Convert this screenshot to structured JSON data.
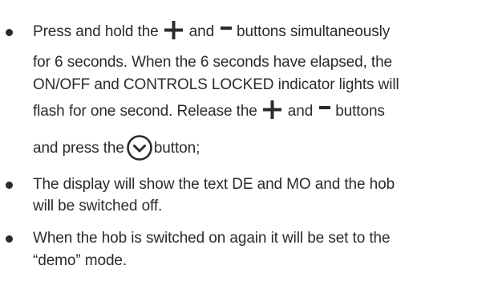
{
  "instructions": {
    "item1": {
      "line1": {
        "before_plus": "Press and hold the",
        "between": "and",
        "after_minus": "buttons simultaneously"
      },
      "line2": "for 6 seconds. When the 6 seconds have elapsed, the",
      "line3": "ON/OFF and CONTROLS LOCKED indicator lights will",
      "line4": {
        "before_plus": "flash for one second. Release the",
        "between": "and",
        "after_minus": "buttons"
      },
      "line5": {
        "before_icon": "and press the",
        "after_icon": "button;"
      }
    },
    "item2": {
      "line1": "The display will show the text DE and MO and the hob",
      "line2": "will be switched off."
    },
    "item3": {
      "line1": "When the hob is switched on again it will be set to the",
      "line2": "“demo” mode."
    }
  },
  "icons": {
    "plus": "plus-icon",
    "minus": "minus-icon",
    "timer": "clock-icon",
    "bullet": "bullet-icon"
  },
  "colors": {
    "text": "#2b2b2b",
    "background": "#ffffff"
  }
}
